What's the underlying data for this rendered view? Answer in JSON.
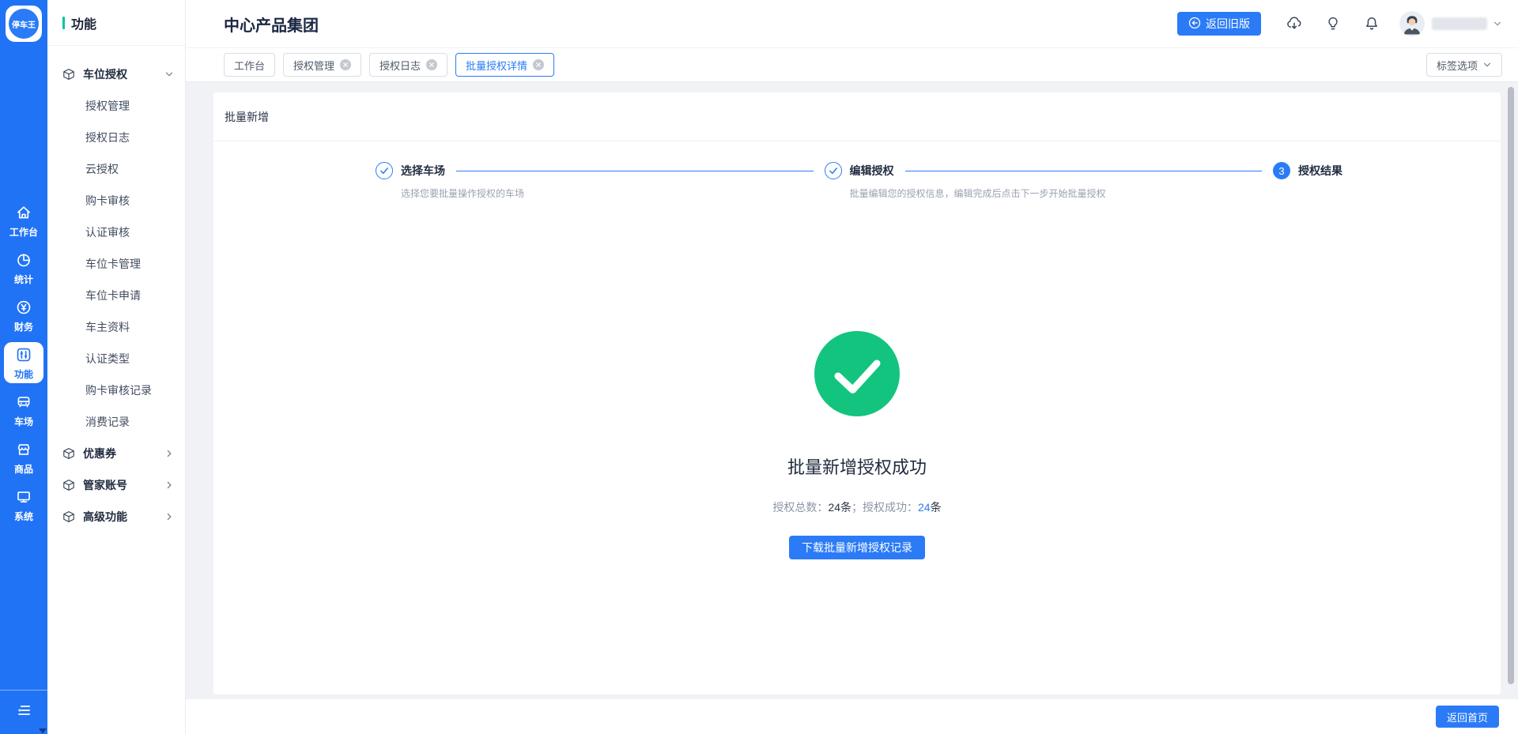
{
  "colors": {
    "rail_blue": "#2173f5",
    "primary_blue": "#2b7bf7",
    "success_green": "#13c47e",
    "teal_accent": "#08c4a2",
    "page_background": "#f0f2f5"
  },
  "app": {
    "logo_text": "停车王"
  },
  "rail": {
    "items": [
      {
        "label": "工作台",
        "icon": "home-icon",
        "active": false
      },
      {
        "label": "统计",
        "icon": "pie-chart-icon",
        "active": false
      },
      {
        "label": "财务",
        "icon": "finance-yen-icon",
        "active": false
      },
      {
        "label": "功能",
        "icon": "sliders-icon",
        "active": true
      },
      {
        "label": "车场",
        "icon": "parking-bus-icon",
        "active": false
      },
      {
        "label": "商品",
        "icon": "shop-icon",
        "active": false
      },
      {
        "label": "系统",
        "icon": "monitor-icon",
        "active": false
      }
    ]
  },
  "sidebar": {
    "title": "功能",
    "groups": [
      {
        "label": "车位授权",
        "expanded": true,
        "children": [
          "授权管理",
          "授权日志",
          "云授权",
          "购卡审核",
          "认证审核",
          "车位卡管理",
          "车位卡申请",
          "车主资料",
          "认证类型",
          "购卡审核记录",
          "消费记录"
        ]
      },
      {
        "label": "优惠券",
        "expanded": false
      },
      {
        "label": "管家账号",
        "expanded": false
      },
      {
        "label": "高级功能",
        "expanded": false
      }
    ]
  },
  "header": {
    "title": "中心产品集团",
    "back_button_label": "返回旧版"
  },
  "tabbar": {
    "tabs": [
      {
        "label": "工作台",
        "closable": false,
        "active": false
      },
      {
        "label": "授权管理",
        "closable": true,
        "active": false
      },
      {
        "label": "授权日志",
        "closable": true,
        "active": false
      },
      {
        "label": "批量授权详情",
        "closable": true,
        "active": true
      }
    ],
    "options_button_label": "标签选项"
  },
  "card": {
    "title": "批量新增"
  },
  "steps": [
    {
      "number": "1",
      "title": "选择车场",
      "description": "选择您要批量操作授权的车场",
      "state": "done"
    },
    {
      "number": "2",
      "title": "编辑授权",
      "description": "批量编辑您的授权信息，编辑完成后点击下一步开始批量授权",
      "state": "done"
    },
    {
      "number": "3",
      "title": "授权结果",
      "description": "",
      "state": "current"
    }
  ],
  "result": {
    "title": "批量新增授权成功",
    "stats": [
      {
        "text": "授权总数：",
        "tone": "muted"
      },
      {
        "text": "24条",
        "tone": "dark"
      },
      {
        "text": "；授权成功：",
        "tone": "muted"
      },
      {
        "text": "24",
        "tone": "blue"
      },
      {
        "text": "条",
        "tone": "dark"
      }
    ],
    "download_button_label": "下载批量新增授权记录"
  },
  "footer": {
    "home_button_label": "返回首页"
  }
}
